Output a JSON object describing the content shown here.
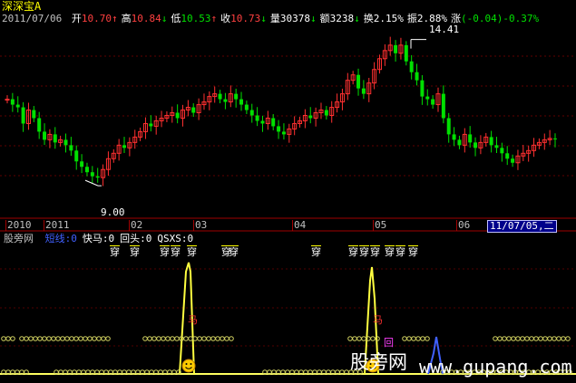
{
  "stock": {
    "name": "深深宝A",
    "color": "#ffff00"
  },
  "header": {
    "date": "2011/07/06",
    "fields": [
      {
        "label": "开",
        "value": "10.70",
        "arrow": "↑",
        "color": "#ff4040"
      },
      {
        "label": "高",
        "value": "10.84",
        "arrow": "↓",
        "color": "#ff4040"
      },
      {
        "label": "低",
        "value": "10.53",
        "arrow": "↑",
        "color": "#00e000"
      },
      {
        "label": "收",
        "value": "10.73",
        "arrow": "↓",
        "color": "#ff4040"
      },
      {
        "label": "量",
        "value": "30378",
        "arrow": "↓",
        "color": "#ffffff"
      },
      {
        "label": "额",
        "value": "3238",
        "arrow": "↓",
        "color": "#ffffff"
      },
      {
        "label": "换",
        "value": "2.15%",
        "arrow": "",
        "color": "#ffffff"
      },
      {
        "label": "振",
        "value": "2.88%",
        "arrow": "",
        "color": "#ffffff"
      },
      {
        "label": "涨",
        "value": "(-0.04)-0.37%",
        "arrow": "",
        "color": "#00e000"
      }
    ]
  },
  "price_annotations": {
    "high": "14.41",
    "low": "9.00"
  },
  "time_axis": {
    "labels": [
      "2010",
      "2011",
      "02",
      "03",
      "04",
      "05",
      "06"
    ],
    "cursor": "11/07/05,二"
  },
  "indicator": {
    "name": "股旁网",
    "params": [
      {
        "text": "短线:0",
        "color": "#4060ff"
      },
      {
        "text": "快马:0",
        "color": "#ffffff"
      },
      {
        "text": "回头:0",
        "color": "#ffffff"
      },
      {
        "text": "QSXS:0",
        "color": "#ffffff"
      }
    ],
    "markers": [
      "穿",
      "穿",
      "穿",
      "穿",
      "穿",
      "穿",
      "穿",
      "穿",
      "穿",
      "穿",
      "穿",
      "穿",
      "穿",
      "穿"
    ],
    "signal_text": [
      "马",
      "马",
      "回"
    ]
  },
  "watermark": {
    "brand": "股旁网",
    "url": "www.gupang.com"
  },
  "chart_data": {
    "type": "candlestick",
    "title": "深深宝A",
    "x_labels": [
      "2010",
      "2011",
      "02",
      "03",
      "04",
      "05",
      "06"
    ],
    "ylim": [
      8.0,
      15.2
    ],
    "high_marker": 14.41,
    "low_marker": 9.0,
    "closes": [
      12.2,
      12.0,
      11.9,
      11.3,
      11.8,
      11.5,
      11.0,
      10.7,
      10.9,
      10.6,
      10.7,
      10.5,
      10.3,
      9.9,
      9.7,
      9.5,
      9.35,
      9.3,
      9.6,
      10.0,
      10.2,
      10.5,
      10.4,
      10.6,
      10.8,
      11.0,
      11.3,
      11.2,
      11.4,
      11.5,
      11.6,
      11.7,
      11.5,
      11.8,
      11.9,
      11.7,
      12.0,
      12.1,
      12.3,
      12.4,
      12.2,
      12.1,
      12.4,
      12.2,
      12.0,
      11.8,
      11.6,
      11.4,
      11.3,
      11.5,
      11.2,
      11.0,
      10.9,
      11.1,
      11.3,
      11.4,
      11.6,
      11.5,
      11.7,
      11.8,
      11.6,
      11.9,
      12.1,
      12.4,
      12.9,
      13.1,
      12.6,
      12.4,
      12.8,
      13.3,
      13.7,
      14.0,
      14.2,
      13.9,
      14.2,
      13.6,
      13.2,
      12.9,
      12.3,
      12.2,
      12.0,
      12.4,
      11.5,
      10.9,
      10.7,
      10.5,
      10.9,
      10.6,
      10.4,
      10.6,
      10.8,
      10.5,
      10.4,
      10.2,
      10.0,
      9.85,
      10.1,
      10.2,
      10.3,
      10.5,
      10.6,
      10.7,
      10.75,
      10.73
    ]
  }
}
